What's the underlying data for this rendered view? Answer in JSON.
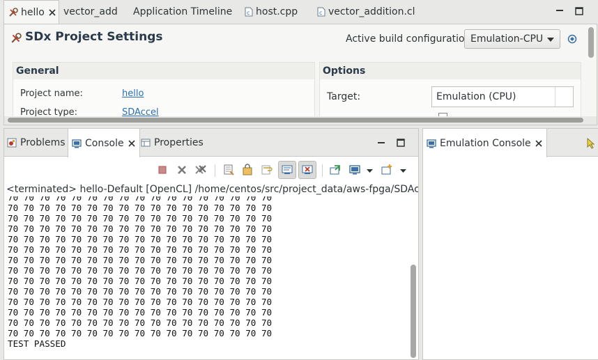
{
  "editor_tabs": [
    {
      "label": "hello",
      "icon": "sdx-project-icon"
    },
    {
      "label": "vector_add"
    },
    {
      "label": "Application Timeline"
    },
    {
      "label": "host.cpp",
      "icon": "c-file-icon"
    },
    {
      "label": "vector_addition.cl",
      "icon": "c-file-icon"
    }
  ],
  "settings": {
    "title": "SDx Project Settings",
    "active_build_label": "Active build configuration:",
    "active_build_value": "Emulation-CPU",
    "general": {
      "heading": "General",
      "project_name_label": "Project name:",
      "project_name_value": "hello",
      "project_type_label": "Project type:",
      "project_type_value": "SDAccel"
    },
    "options": {
      "heading": "Options",
      "target_label": "Target:",
      "target_value": "Emulation (CPU)"
    }
  },
  "bottom_tabs": {
    "problems": "Problems",
    "console": "Console",
    "properties": "Properties"
  },
  "console": {
    "terminated_line": "<terminated> hello-Default [OpenCL] /home/centos/src/project_data/aws-fpga/SDAccel/exa",
    "output_lines": [
      "70 70 70 70 70 70 70 70 70 70 70 70 70 70 70 70 70",
      "70 70 70 70 70 70 70 70 70 70 70 70 70 70 70 70 70",
      "70 70 70 70 70 70 70 70 70 70 70 70 70 70 70 70 70",
      "70 70 70 70 70 70 70 70 70 70 70 70 70 70 70 70 70",
      "70 70 70 70 70 70 70 70 70 70 70 70 70 70 70 70 70",
      "70 70 70 70 70 70 70 70 70 70 70 70 70 70 70 70 70",
      "70 70 70 70 70 70 70 70 70 70 70 70 70 70 70 70 70",
      "70 70 70 70 70 70 70 70 70 70 70 70 70 70 70 70 70",
      "70 70 70 70 70 70 70 70 70 70 70 70 70 70 70 70 70",
      "70 70 70 70 70 70 70 70 70 70 70 70 70 70 70 70 70",
      "70 70 70 70 70 70 70 70 70 70 70 70 70 70 70 70 70",
      "70 70 70 70 70 70 70 70 70 70 70 70 70 70 70 70 70",
      "70 70 70 70 70 70 70 70 70 70 70 70 70 70 70 70 70",
      "70 70 70 70 70 70 70 70 70 70 70 70 70 70 70 70 70",
      "TEST PASSED"
    ]
  },
  "emulation_console": {
    "tab_label": "Emulation Console"
  },
  "colors": {
    "link": "#2a6fb5",
    "panel_bg": "#f6f6f5",
    "chrome_bg": "#e8e8e7"
  }
}
